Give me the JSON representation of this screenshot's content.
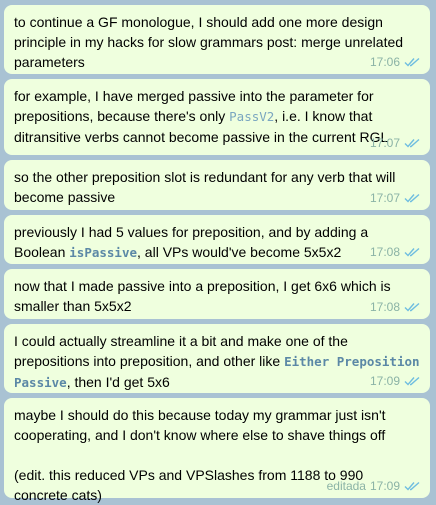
{
  "messages": [
    {
      "parts": [
        {
          "t": "to continue a GF monologue, I should add one more design principle in my hacks for slow grammars post: merge unrelated parameters"
        }
      ],
      "time": "17:06"
    },
    {
      "parts": [
        {
          "t": "for example, I have merged passive into the parameter for prepositions, because there's only "
        },
        {
          "code": "PassV2"
        },
        {
          "t": ", i.e. I know that ditransitive verbs cannot become passive in the current RGL"
        }
      ],
      "time": "17:07"
    },
    {
      "parts": [
        {
          "t": "so the other preposition slot is redundant for any verb that will become passive"
        }
      ],
      "time": "17:07"
    },
    {
      "parts": [
        {
          "t": "previously I had 5 values for preposition, and  by adding a Boolean "
        },
        {
          "code": "isPassive"
        },
        {
          "t": ", all VPs would've become 5x5x2"
        }
      ],
      "time": "17:08"
    },
    {
      "parts": [
        {
          "t": "now that I made passive into a preposition, I get 6x6 which is smaller than 5x5x2"
        }
      ],
      "time": "17:08"
    },
    {
      "parts": [
        {
          "t": "I could actually streamline it a bit and make one of the prepositions into preposition, and other like "
        },
        {
          "code": "Either Preposition Passive"
        },
        {
          "t": ", then I'd get 5x6"
        }
      ],
      "time": "17:09"
    },
    {
      "parts": [
        {
          "t": "maybe I should do this because today my grammar just isn't cooperating, and I don't know where else to shave things off"
        },
        {
          "t": "(edit. this reduced VPs and VPSlashes from 1188 to 990 concrete cats)"
        }
      ],
      "edited_label": "editada",
      "time": "17:09"
    }
  ]
}
